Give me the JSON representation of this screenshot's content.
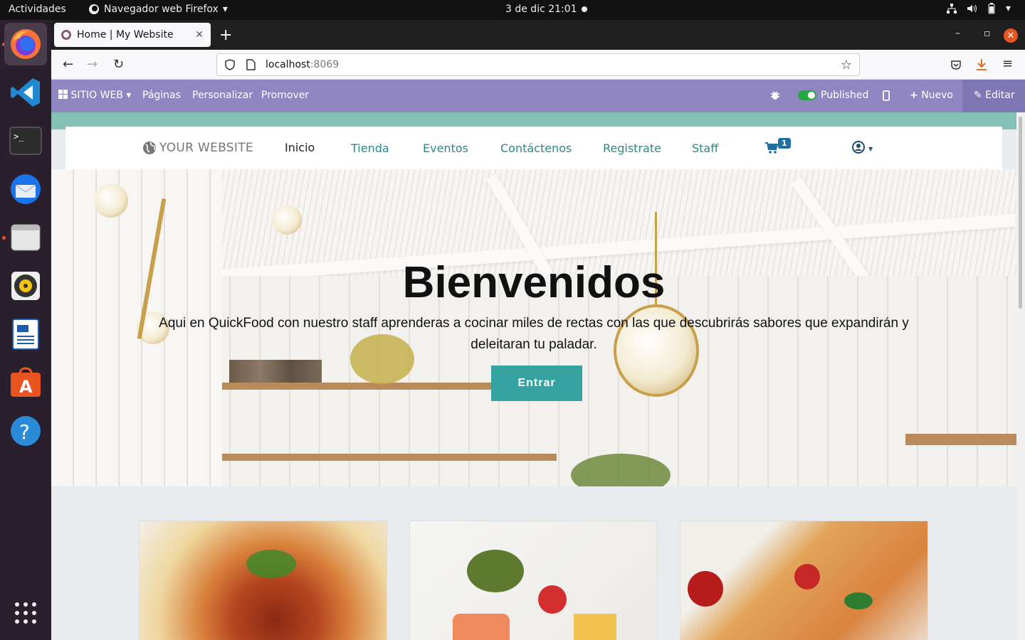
{
  "os": {
    "activities": "Actividades",
    "app_menu": "Navegador web Firefox",
    "clock": "3 de dic  21:01"
  },
  "dock": {
    "items": [
      "firefox",
      "vscode",
      "terminal",
      "thunderbird",
      "files",
      "rhythmbox",
      "writer",
      "software-center",
      "help",
      "show-apps"
    ]
  },
  "browser": {
    "tab_title": "Home | My Website",
    "url_host": "localhost",
    "url_port": ":8069"
  },
  "odoo_bar": {
    "app_menu": "SITIO WEB",
    "pages": "Páginas",
    "customize": "Personalizar",
    "promote": "Promover",
    "published": "Published",
    "new": "Nuevo",
    "edit": "Editar"
  },
  "site_nav": {
    "logo": "YOUR WEBSITE",
    "links": [
      "Inicio",
      "Tienda",
      "Eventos",
      "Contáctenos",
      "Registrate",
      "Staff"
    ],
    "cart_count": "1"
  },
  "hero": {
    "title": "Bienvenidos",
    "text": "Aqui en QuickFood con nuestro staff aprenderas a cocinar miles de rectas con las que descubrirás sabores que expandirán y deleitaran tu paladar.",
    "button": "Entrar"
  },
  "colors": {
    "admin_bar": "#8f86c2",
    "accent": "#35a4a0",
    "page_top": "#83c1b6",
    "ubuntu_orange": "#e95420"
  }
}
